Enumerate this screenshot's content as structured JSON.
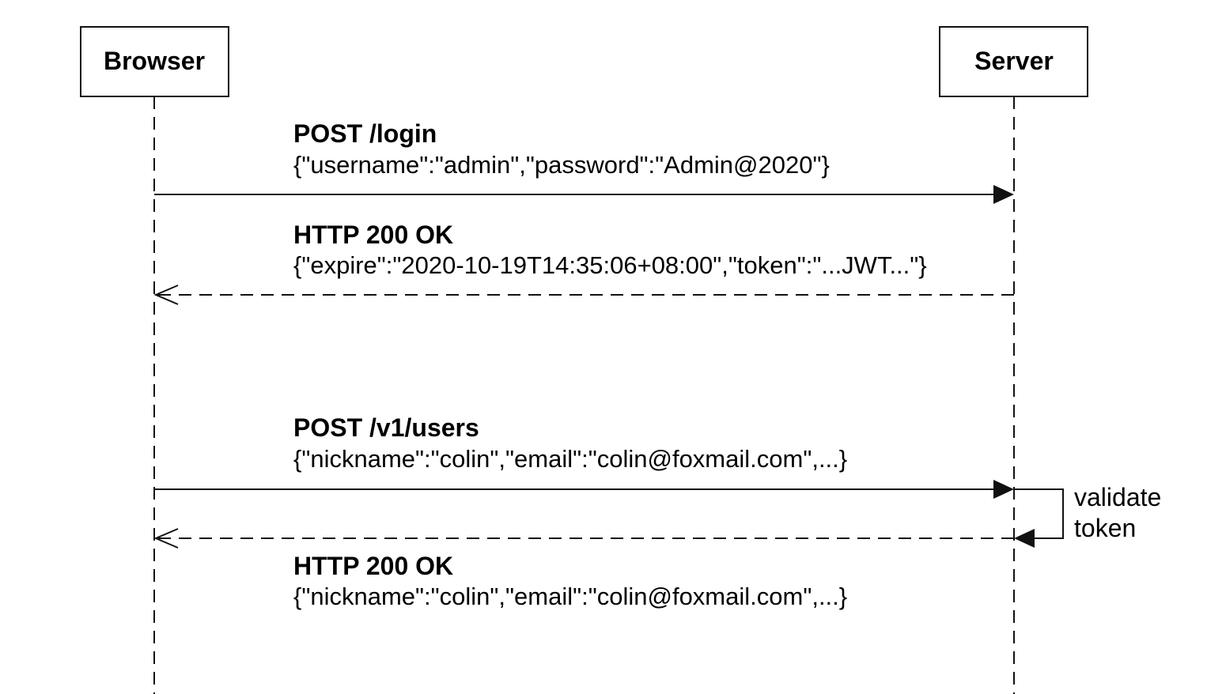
{
  "diagram": {
    "type": "sequence",
    "actors": {
      "browser": "Browser",
      "server": "Server"
    },
    "messages": [
      {
        "title": "POST /login",
        "body": "{\"username\":\"admin\",\"password\":\"Admin@2020\"}"
      },
      {
        "title": "HTTP 200 OK",
        "body": "{\"expire\":\"2020-10-19T14:35:06+08:00\",\"token\":\"...JWT...\"}"
      },
      {
        "title": "POST /v1/users",
        "body": "{\"nickname\":\"colin\",\"email\":\"colin@foxmail.com\",...}"
      },
      {
        "title": "HTTP 200 OK",
        "body": "{\"nickname\":\"colin\",\"email\":\"colin@foxmail.com\",...}"
      }
    ],
    "self_note": [
      "validate",
      "token"
    ]
  }
}
